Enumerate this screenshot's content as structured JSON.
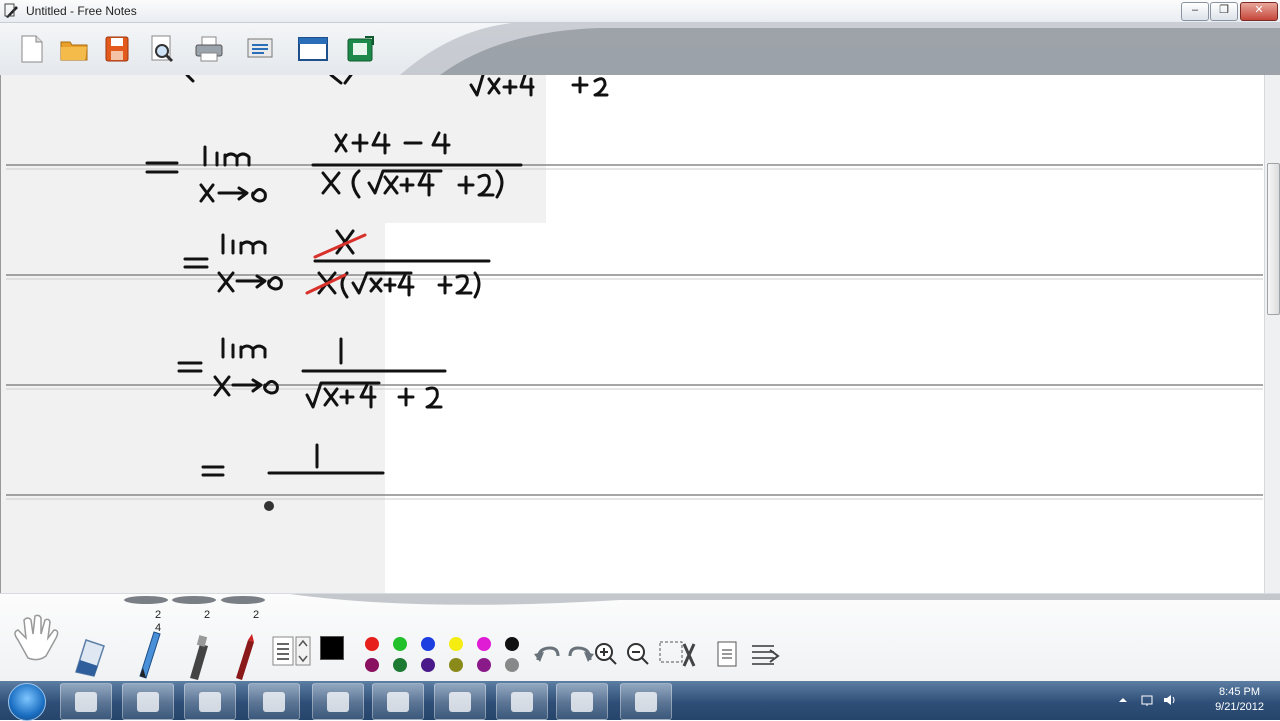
{
  "window": {
    "title": "Untitled - Free Notes",
    "minimize_label": "–",
    "maximize_label": "❐",
    "close_label": "✕"
  },
  "toolbar": {
    "buttons": [
      "new-file",
      "open-folder",
      "save",
      "print-preview",
      "print",
      "scan",
      "window",
      "export"
    ]
  },
  "canvas": {
    "note_lines": [
      "√x+4 + 2",
      "= lim x→0 (x+4 − 4) / x(√x+4 + 2)",
      "= lim x→0 x / x(√x+4 + 2)",
      "= lim x→0 1 / (√x+4 + 2)",
      "= 1 / ____"
    ],
    "ink_color": "#111111",
    "cancel_color": "#d8302a"
  },
  "tools": {
    "pen_sizes": [
      "2",
      "2",
      "2"
    ],
    "pen_sub_size": "4",
    "colors_top": [
      "#e8201c",
      "#22c02a",
      "#1b3fe0",
      "#f5ec12",
      "#e01cd5",
      "#111111"
    ],
    "colors_bottom": [
      "#8a1060",
      "#1d7a32",
      "#4a1a8a",
      "#8a8a1a",
      "#8a1a8a",
      "#888888"
    ]
  },
  "taskbar": {
    "time": "8:45 PM",
    "date": "9/21/2012",
    "apps": [
      "internet-explorer",
      "file-explorer",
      "media-player",
      "network-tool",
      "free-notes",
      "dice-app",
      "captivate",
      "game-app",
      "notes-app",
      "free-notes-2"
    ]
  }
}
